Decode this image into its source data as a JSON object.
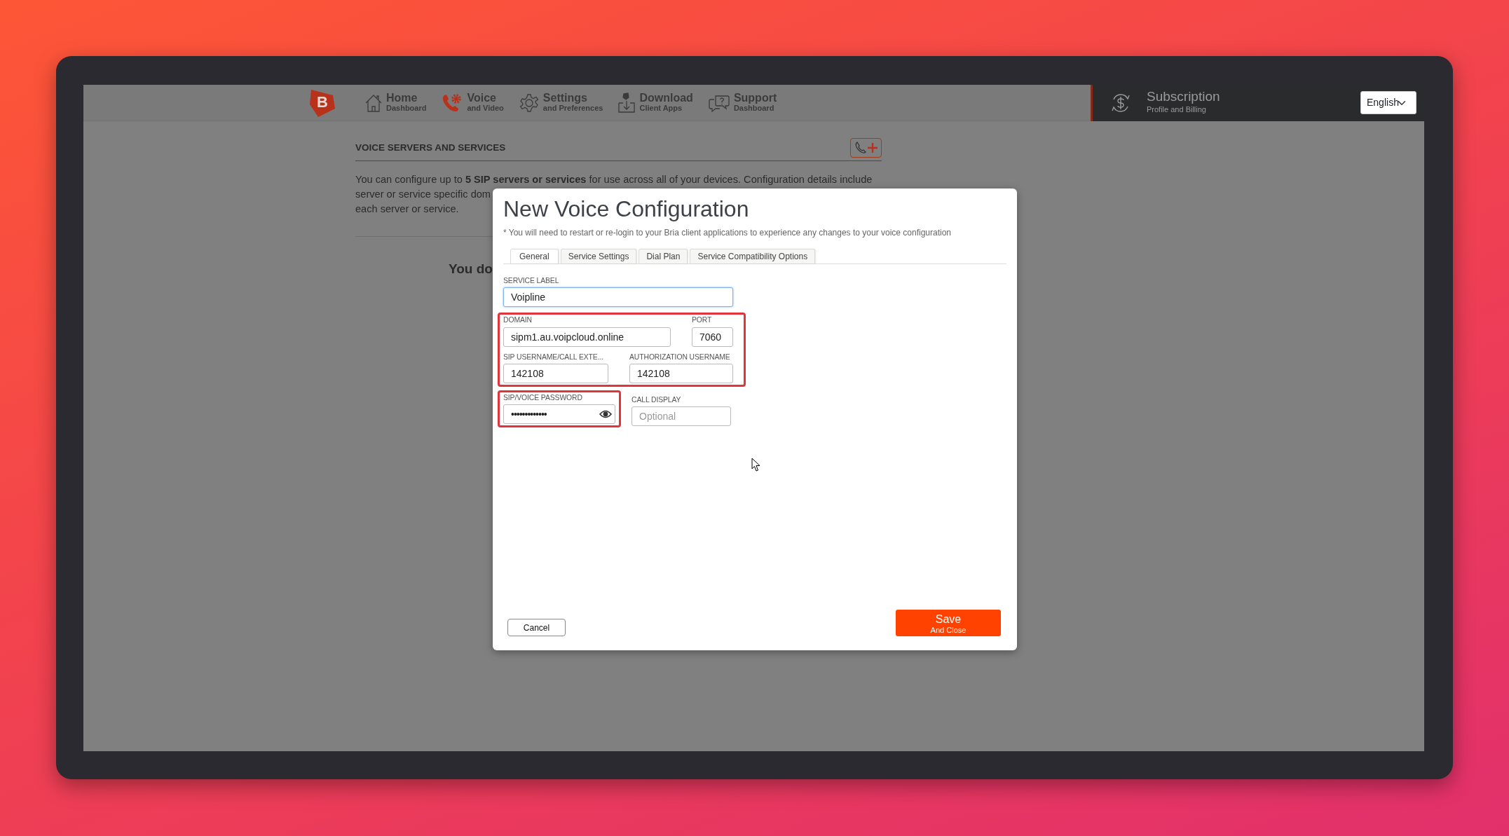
{
  "logo": {
    "letter": "B"
  },
  "nav": {
    "items": [
      {
        "kind": "home",
        "title": "Home",
        "subtitle": "Dashboard",
        "selected": false
      },
      {
        "kind": "voice",
        "title": "Voice",
        "subtitle": "and Video",
        "selected": true
      },
      {
        "kind": "settings",
        "title": "Settings",
        "subtitle": "and Preferences",
        "selected": false
      },
      {
        "kind": "download",
        "title": "Download",
        "subtitle": "Client Apps",
        "selected": false
      },
      {
        "kind": "support",
        "title": "Support",
        "subtitle": "Dashboard",
        "selected": false
      }
    ]
  },
  "subscription": {
    "title": "Subscription",
    "subtitle": "Profile and Billing"
  },
  "language": {
    "value": "English"
  },
  "page": {
    "heading": "VOICE SERVERS AND SERVICES",
    "description_lines": [
      "You can configure up to **5 SIP servers or services** for use across all of your devices. Configuration details include",
      "server or service specific dom",
      "each server or service."
    ],
    "empty_message": "You do"
  },
  "modal": {
    "title": "New Voice Configuration",
    "note": "* You will need to restart or re-login to your Bria client applications to experience any changes to your voice configuration",
    "tabs": [
      {
        "label": "General",
        "selected": true
      },
      {
        "label": "Service Settings",
        "selected": false
      },
      {
        "label": "Dial Plan",
        "selected": false
      },
      {
        "label": "Service Compatibility Options",
        "selected": false
      }
    ],
    "field_groups": [
      {
        "highlighted": false,
        "fields": [
          {
            "kind": "text",
            "label": "SERVICE LABEL",
            "value": "Voipline",
            "focused": true
          }
        ]
      },
      {
        "highlighted": true,
        "fields": [
          {
            "kind": "text",
            "label": "DOMAIN",
            "value": "sipm1.au.voipcloud.online",
            "focused": false
          },
          {
            "kind": "text",
            "label": "PORT",
            "value": "7060",
            "focused": false
          },
          {
            "kind": "text",
            "label": "SIP USERNAME/CALL EXTE...",
            "value": "142108",
            "focused": false
          },
          {
            "kind": "text",
            "label": "AUTHORIZATION USERNAME",
            "value": "142108",
            "focused": false
          }
        ]
      },
      {
        "highlighted": true,
        "fields": [
          {
            "kind": "password",
            "label": "SIP/VOICE PASSWORD",
            "value": "•••••••••••••",
            "focused": false
          }
        ]
      },
      {
        "highlighted": false,
        "fields": [
          {
            "kind": "text",
            "label": "CALL DISPLAY",
            "placeholder": "Optional",
            "focused": false
          }
        ]
      }
    ],
    "cancel": {
      "label": "Cancel"
    },
    "save": {
      "label": "Save",
      "sublabel": "And Close"
    }
  }
}
